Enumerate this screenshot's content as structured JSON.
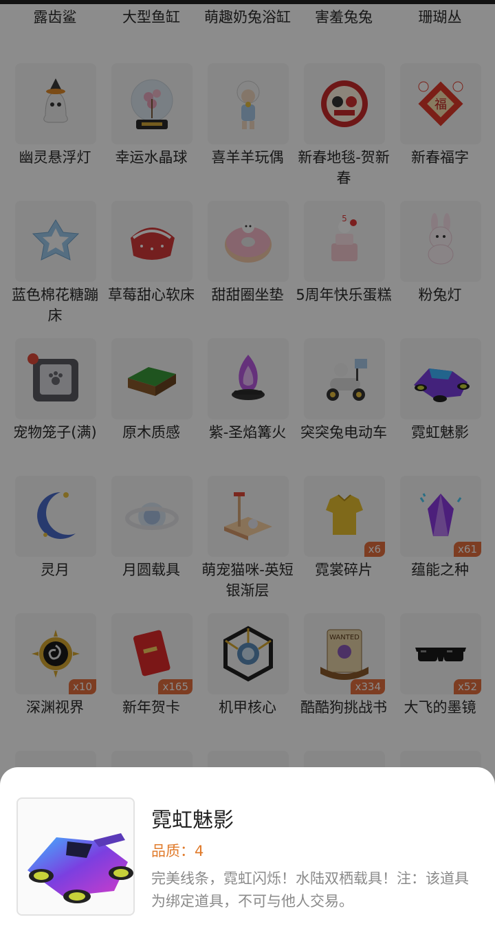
{
  "top_row_labels": [
    "露齿鲨",
    "大型鱼缸",
    "萌趣奶兔浴缸",
    "害羞兔兔",
    "珊瑚丛"
  ],
  "items": [
    {
      "row": 0,
      "col": 0,
      "label": "幽灵悬浮灯",
      "icon": "ghost-lamp-icon",
      "badge": null
    },
    {
      "row": 0,
      "col": 1,
      "label": "幸运水晶球",
      "icon": "crystal-ball-icon",
      "badge": null
    },
    {
      "row": 0,
      "col": 2,
      "label": "喜羊羊玩偶",
      "icon": "sheep-doll-icon",
      "badge": null
    },
    {
      "row": 0,
      "col": 3,
      "label": "新春地毯-贺新春",
      "icon": "new-year-carpet-icon",
      "badge": null
    },
    {
      "row": 0,
      "col": 4,
      "label": "新春福字",
      "icon": "fu-character-icon",
      "badge": null
    },
    {
      "row": 1,
      "col": 0,
      "label": "蓝色棉花糖蹦床",
      "icon": "marshmallow-trampoline-icon",
      "badge": null
    },
    {
      "row": 1,
      "col": 1,
      "label": "草莓甜心软床",
      "icon": "strawberry-bed-icon",
      "badge": null
    },
    {
      "row": 1,
      "col": 2,
      "label": "甜甜圈坐垫",
      "icon": "donut-cushion-icon",
      "badge": null
    },
    {
      "row": 1,
      "col": 3,
      "label": "5周年快乐蛋糕",
      "icon": "anniversary-cake-icon",
      "badge": null
    },
    {
      "row": 1,
      "col": 4,
      "label": "粉兔灯",
      "icon": "pink-rabbit-lamp-icon",
      "badge": null
    },
    {
      "row": 2,
      "col": 0,
      "label": "宠物笼子(满)",
      "icon": "pet-cage-icon",
      "badge": null
    },
    {
      "row": 2,
      "col": 1,
      "label": "原木质感",
      "icon": "wood-block-icon",
      "badge": null
    },
    {
      "row": 2,
      "col": 2,
      "label": "紫-圣焰篝火",
      "icon": "purple-bonfire-icon",
      "badge": null
    },
    {
      "row": 2,
      "col": 3,
      "label": "突突兔电动车",
      "icon": "electric-scooter-icon",
      "badge": null
    },
    {
      "row": 2,
      "col": 4,
      "label": "霓虹魅影",
      "icon": "neon-kart-icon",
      "badge": null
    },
    {
      "row": 3,
      "col": 0,
      "label": "灵月",
      "icon": "crescent-moon-icon",
      "badge": null
    },
    {
      "row": 3,
      "col": 1,
      "label": "月圆载具",
      "icon": "moon-vehicle-icon",
      "badge": null
    },
    {
      "row": 3,
      "col": 2,
      "label": "萌宠猫咪-英短银渐层",
      "icon": "cat-tower-icon",
      "badge": null
    },
    {
      "row": 3,
      "col": 3,
      "label": "霓裳碎片",
      "icon": "clothing-shard-icon",
      "badge": "x6"
    },
    {
      "row": 3,
      "col": 4,
      "label": "蕴能之种",
      "icon": "energy-crystal-icon",
      "badge": "x61"
    },
    {
      "row": 4,
      "col": 0,
      "label": "深渊视界",
      "icon": "abyss-sun-icon",
      "badge": "x10"
    },
    {
      "row": 4,
      "col": 1,
      "label": "新年贺卡",
      "icon": "red-envelope-icon",
      "badge": "x165"
    },
    {
      "row": 4,
      "col": 2,
      "label": "机甲核心",
      "icon": "mech-core-icon",
      "badge": null
    },
    {
      "row": 4,
      "col": 3,
      "label": "酷酷狗挑战书",
      "icon": "wanted-scroll-icon",
      "badge": "x334"
    },
    {
      "row": 4,
      "col": 4,
      "label": "大飞的墨镜",
      "icon": "sunglasses-icon",
      "badge": "x52"
    }
  ],
  "detail": {
    "title": "霓虹魅影",
    "quality": "品质：4",
    "description": "完美线条，霓虹闪烁！水陆双栖载具！注：该道具为绑定道具，不可与他人交易。",
    "icon": "neon-kart-icon"
  }
}
